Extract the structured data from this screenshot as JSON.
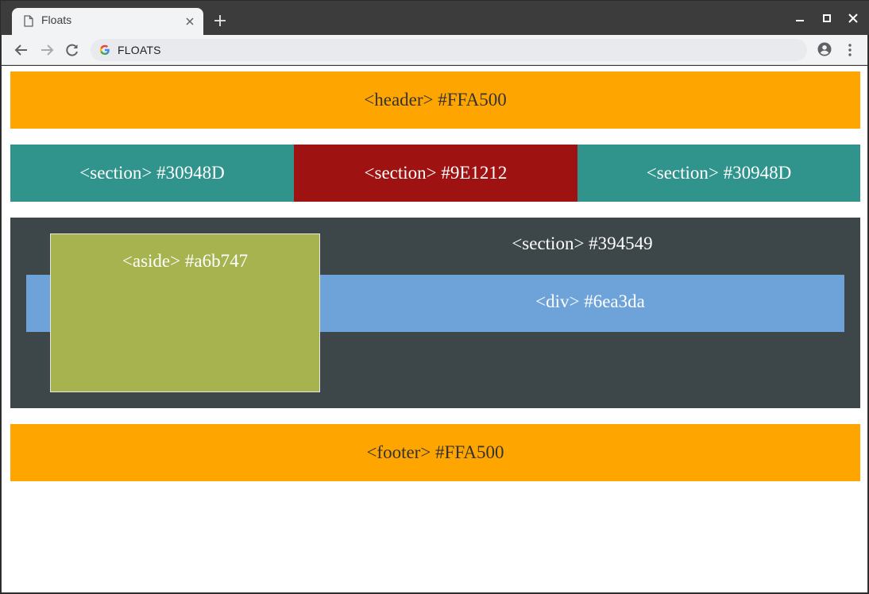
{
  "browser": {
    "tab_title": "Floats",
    "url": "FLOATS"
  },
  "page": {
    "header": {
      "label": "<header> #FFA500",
      "color": "#FFA500"
    },
    "sections": [
      {
        "label": "<section> #30948D",
        "color": "#30948D"
      },
      {
        "label": "<section> #9E1212",
        "color": "#9E1212"
      },
      {
        "label": "<section> #30948D",
        "color": "#30948D"
      }
    ],
    "big_section": {
      "label": "<section> #394549",
      "color": "#3d4749"
    },
    "inner_div": {
      "label": "<div> #6ea3da",
      "color": "#6ea3da"
    },
    "aside": {
      "label": "<aside> #a6b747",
      "color": "#a6b34f"
    },
    "footer": {
      "label": "<footer> #FFA500",
      "color": "#FFA500"
    }
  },
  "icons": {
    "tab_page": "page-icon",
    "tab_close": "close-icon",
    "new_tab": "plus-icon",
    "back": "back-arrow-icon",
    "forward": "forward-arrow-icon",
    "reload": "reload-icon",
    "search_engine": "google-g-icon",
    "account": "account-icon",
    "menu": "kebab-menu-icon",
    "minimize": "minimize-icon",
    "maximize": "maximize-icon",
    "close": "window-close-icon"
  }
}
